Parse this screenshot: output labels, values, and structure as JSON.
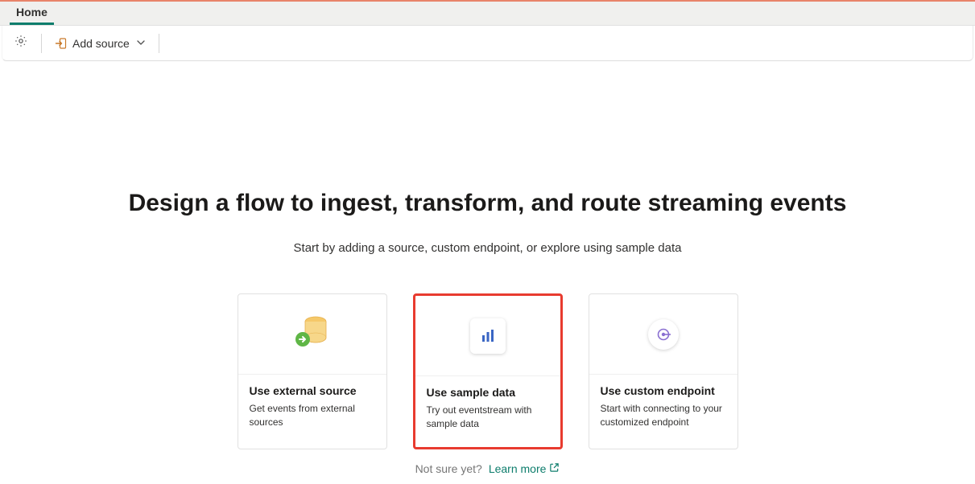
{
  "tabs": {
    "home": "Home"
  },
  "ribbon": {
    "add_source_label": "Add source"
  },
  "hero": {
    "title": "Design a flow to ingest, transform, and route streaming events",
    "subtitle": "Start by adding a source, custom endpoint, or explore using sample data"
  },
  "cards": {
    "external": {
      "title": "Use external source",
      "desc": "Get events from external sources"
    },
    "sample": {
      "title": "Use sample data",
      "desc": "Try out eventstream with sample data"
    },
    "custom": {
      "title": "Use custom endpoint",
      "desc": "Start with connecting to your customized endpoint"
    }
  },
  "footer": {
    "not_sure": "Not sure yet?",
    "learn_more": "Learn more"
  }
}
